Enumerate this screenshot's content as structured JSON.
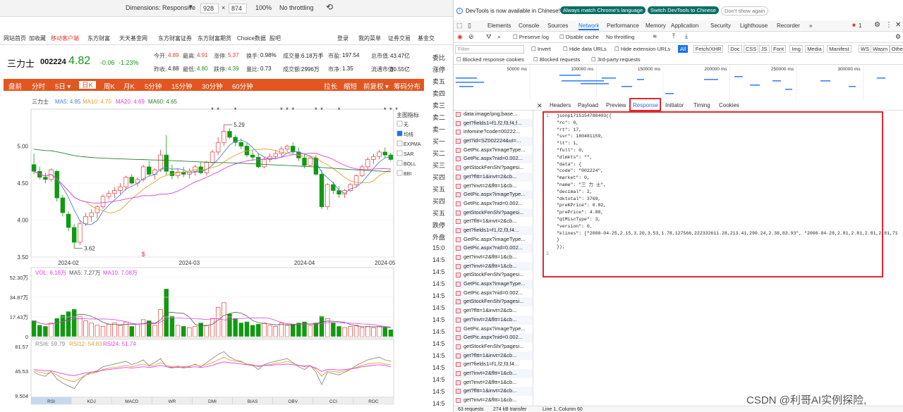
{
  "device_toolbar": {
    "dimensions_label": "Dimensions: Responsive",
    "width": "928",
    "times": "×",
    "height": "874",
    "zoom": "100%",
    "throttle": "No throttling"
  },
  "site_nav": [
    "网站首页",
    "加收藏",
    "移动客户端",
    "东方财富",
    "天天基金网",
    "东方财富证券",
    "东方财富期货",
    "Choice数据",
    "股吧"
  ],
  "site_nav_right": [
    "登录",
    "我的菜单",
    "证券交易",
    "基金交"
  ],
  "stock": {
    "name": "三力士",
    "code": "002224",
    "price": "4.82",
    "change": "-0.06",
    "change_pct": "-1.23%",
    "row1": [
      {
        "label": "今开:",
        "value": "4.89",
        "color": "red"
      },
      {
        "label": "最高:",
        "value": "4.91",
        "color": "red"
      },
      {
        "label": "涨停:",
        "value": "5.37",
        "color": "red"
      },
      {
        "label": "换手:",
        "value": "0.98%",
        "color": "plain"
      },
      {
        "label": "成交量:",
        "value": "6.18万手",
        "color": "plain"
      },
      {
        "label": "市盈:",
        "value": "197.54",
        "color": "plain"
      },
      {
        "label": "总市值:",
        "value": "43.47亿",
        "color": "plain"
      }
    ],
    "row2": [
      {
        "label": "昨收:",
        "value": "4.88",
        "color": "plain"
      },
      {
        "label": "最低:",
        "value": "4.80",
        "color": "green"
      },
      {
        "label": "跌停:",
        "value": "4.39",
        "color": "green"
      },
      {
        "label": "量比:",
        "value": "0.73",
        "color": "plain"
      },
      {
        "label": "成交额:",
        "value": "2996万",
        "color": "plain"
      },
      {
        "label": "市净:",
        "value": "1.35",
        "color": "plain"
      },
      {
        "label": "流通市值:",
        "value": "30.55亿",
        "color": "plain"
      }
    ]
  },
  "period_tabs": [
    "盘前",
    "分时",
    "5日 ▾",
    "日K",
    "周K",
    "月K",
    "5分钟",
    "15分钟",
    "30分钟",
    "60分钟"
  ],
  "period_active": "日K",
  "period_right": [
    "拉长",
    "缩短",
    "前复权 ▾",
    "筹码分布"
  ],
  "chart_header": {
    "name": "三力士",
    "ma": [
      {
        "label": "MA5: 4.85",
        "color": "#4f7fd6"
      },
      {
        "label": "MA10: 4.70",
        "color": "#e0a030"
      },
      {
        "label": "MA20: 4.69",
        "color": "#e040e0"
      },
      {
        "label": "MA60: 4.65",
        "color": "#2e7d32"
      }
    ]
  },
  "indicator_panel": {
    "title": "主图指标",
    "options": [
      "无",
      "均线",
      "EXPMA",
      "SAR",
      "BOLL",
      "BBI"
    ],
    "checked": "均线"
  },
  "bottom_tabs": [
    "RSI",
    "KDJ",
    "MACD",
    "WR",
    "DMI",
    "BIAS",
    "OBV",
    "CCI",
    "ROC"
  ],
  "chart_data": [
    {
      "type": "candlestick",
      "title": "三力士",
      "ylim": [
        3.5,
        5.5
      ],
      "yticks": [
        "5.00",
        "4.50",
        "4.00",
        "3.50"
      ],
      "xticks": [
        "2024-02",
        "2024-03",
        "2024-04",
        "2024-05"
      ],
      "annotations": [
        "5.29",
        "3.62"
      ],
      "series": [
        {
          "name": "MA5: 4.85"
        },
        {
          "name": "MA10: 4.70"
        },
        {
          "name": "MA20: 4.69"
        },
        {
          "name": "MA60: 4.65"
        }
      ],
      "ohlc": [
        [
          4.75,
          4.9,
          4.62,
          4.66
        ],
        [
          4.66,
          4.72,
          4.55,
          4.58
        ],
        [
          4.58,
          4.64,
          4.5,
          4.55
        ],
        [
          4.55,
          4.7,
          4.52,
          4.68
        ],
        [
          4.66,
          4.68,
          4.25,
          4.3
        ],
        [
          4.3,
          4.34,
          4.05,
          4.1
        ],
        [
          4.08,
          4.12,
          3.85,
          3.9
        ],
        [
          3.9,
          3.95,
          3.62,
          3.7
        ],
        [
          3.7,
          3.98,
          3.66,
          3.95
        ],
        [
          3.95,
          4.1,
          3.92,
          4.05
        ],
        [
          4.05,
          4.15,
          3.98,
          4.1
        ],
        [
          4.1,
          4.2,
          4.02,
          4.18
        ],
        [
          4.18,
          4.35,
          4.15,
          4.32
        ],
        [
          4.32,
          4.4,
          4.28,
          4.36
        ],
        [
          4.36,
          4.45,
          4.3,
          4.4
        ],
        [
          4.4,
          4.5,
          4.35,
          4.45
        ],
        [
          4.45,
          4.6,
          4.4,
          4.58
        ],
        [
          4.58,
          4.62,
          4.48,
          4.5
        ],
        [
          4.5,
          4.58,
          4.45,
          4.55
        ],
        [
          4.55,
          4.75,
          4.52,
          4.72
        ],
        [
          4.72,
          4.8,
          4.6,
          4.62
        ],
        [
          4.62,
          4.7,
          4.55,
          4.68
        ],
        [
          4.68,
          4.95,
          4.65,
          4.88
        ],
        [
          4.88,
          5.15,
          4.6,
          4.66
        ],
        [
          4.66,
          4.75,
          4.55,
          4.6
        ],
        [
          4.6,
          4.7,
          4.56,
          4.65
        ],
        [
          4.65,
          4.72,
          4.58,
          4.62
        ],
        [
          4.62,
          4.7,
          4.56,
          4.66
        ],
        [
          4.66,
          4.75,
          4.6,
          4.72
        ],
        [
          4.72,
          4.78,
          4.62,
          4.64
        ],
        [
          4.64,
          4.8,
          4.6,
          4.78
        ],
        [
          4.78,
          4.95,
          4.75,
          4.92
        ],
        [
          4.92,
          5.12,
          4.88,
          5.05
        ],
        [
          5.05,
          5.29,
          5.0,
          5.2
        ],
        [
          5.2,
          5.24,
          5.1,
          5.12
        ],
        [
          5.12,
          5.15,
          5.0,
          5.05
        ],
        [
          5.05,
          5.1,
          4.96,
          5.0
        ],
        [
          5.0,
          5.04,
          4.85,
          4.88
        ],
        [
          4.88,
          4.95,
          4.8,
          4.85
        ],
        [
          4.85,
          4.9,
          4.7,
          4.72
        ],
        [
          4.72,
          4.85,
          4.7,
          4.82
        ],
        [
          4.82,
          4.9,
          4.78,
          4.86
        ],
        [
          4.86,
          4.95,
          4.82,
          4.9
        ],
        [
          4.9,
          5.0,
          4.86,
          4.96
        ],
        [
          4.96,
          5.02,
          4.92,
          5.0
        ],
        [
          5.0,
          5.05,
          4.9,
          4.92
        ],
        [
          4.92,
          4.98,
          4.8,
          4.84
        ],
        [
          4.84,
          4.9,
          4.7,
          4.74
        ],
        [
          4.74,
          4.86,
          4.72,
          4.84
        ],
        [
          4.84,
          4.88,
          4.6,
          4.62
        ],
        [
          4.62,
          4.68,
          4.15,
          4.18
        ],
        [
          4.18,
          4.5,
          4.14,
          4.48
        ],
        [
          4.48,
          4.52,
          4.35,
          4.4
        ],
        [
          4.4,
          4.46,
          4.3,
          4.35
        ],
        [
          4.35,
          4.42,
          4.3,
          4.4
        ],
        [
          4.4,
          4.5,
          4.38,
          4.48
        ],
        [
          4.48,
          4.62,
          4.45,
          4.6
        ],
        [
          4.6,
          4.75,
          4.58,
          4.72
        ],
        [
          4.72,
          4.85,
          4.68,
          4.82
        ],
        [
          4.82,
          4.9,
          4.76,
          4.86
        ],
        [
          4.86,
          4.95,
          4.82,
          4.92
        ],
        [
          4.92,
          4.98,
          4.84,
          4.88
        ],
        [
          4.88,
          4.91,
          4.8,
          4.82
        ]
      ]
    },
    {
      "type": "bar",
      "title": "VOL: 6.18万",
      "ylim": [
        0,
        52.3
      ],
      "yticks": [
        "52.30万",
        "34.87万",
        "17.43万",
        "0"
      ],
      "series": [
        {
          "name": "MA5: 7.27万"
        },
        {
          "name": "MA10: 7.08万"
        }
      ],
      "values": [
        14,
        10,
        9,
        12,
        16,
        19,
        22,
        24,
        18,
        14,
        12,
        10,
        9,
        11,
        12,
        10,
        13,
        9,
        11,
        15,
        14,
        10,
        24,
        42,
        18,
        10,
        9,
        8,
        9,
        12,
        10,
        16,
        26,
        30,
        20,
        16,
        12,
        13,
        10,
        11,
        12,
        10,
        9,
        12,
        10,
        11,
        12,
        13,
        10,
        12,
        18,
        16,
        12,
        9,
        8,
        9,
        10,
        8,
        9,
        8,
        9,
        8,
        6
      ],
      "bar_up": [
        false,
        false,
        false,
        true,
        false,
        false,
        false,
        false,
        true,
        true,
        true,
        true,
        true,
        true,
        true,
        true,
        true,
        false,
        true,
        true,
        false,
        true,
        true,
        false,
        false,
        true,
        false,
        true,
        true,
        false,
        true,
        true,
        true,
        true,
        false,
        false,
        false,
        false,
        false,
        false,
        true,
        true,
        true,
        true,
        true,
        false,
        false,
        false,
        true,
        false,
        false,
        true,
        false,
        false,
        true,
        true,
        true,
        true,
        true,
        true,
        true,
        false,
        false
      ]
    },
    {
      "type": "line",
      "title": "RSI",
      "ylim": [
        9.504,
        81.57
      ],
      "yticks": [
        "81.57",
        "45.53",
        "9.504"
      ],
      "series": [
        {
          "name": "RSI6: 59.79",
          "values": [
            44,
            40,
            38,
            45,
            34,
            28,
            24,
            20,
            32,
            40,
            44,
            46,
            52,
            54,
            56,
            58,
            60,
            55,
            58,
            62,
            54,
            58,
            64,
            52,
            50,
            52,
            50,
            52,
            56,
            52,
            58,
            64,
            70,
            74,
            66,
            62,
            60,
            55,
            54,
            48,
            55,
            58,
            60,
            62,
            64,
            58,
            52,
            48,
            54,
            44,
            26,
            44,
            42,
            40,
            44,
            48,
            54,
            58,
            62,
            64,
            66,
            62,
            60
          ]
        },
        {
          "name": "RSI12: 54.83",
          "values": [
            46,
            44,
            42,
            44,
            40,
            35,
            32,
            30,
            35,
            40,
            42,
            44,
            48,
            50,
            51,
            52,
            54,
            52,
            54,
            56,
            53,
            54,
            58,
            54,
            52,
            53,
            52,
            53,
            55,
            53,
            55,
            58,
            62,
            66,
            62,
            60,
            59,
            56,
            55,
            52,
            54,
            55,
            57,
            58,
            60,
            57,
            54,
            52,
            54,
            48,
            38,
            46,
            45,
            44,
            46,
            48,
            51,
            54,
            56,
            57,
            58,
            56,
            55
          ]
        },
        {
          "name": "RSI24: 51.74",
          "values": [
            48,
            47,
            46,
            46,
            44,
            42,
            40,
            39,
            41,
            43,
            44,
            45,
            47,
            48,
            49,
            50,
            51,
            50,
            51,
            52,
            51,
            52,
            54,
            52,
            51,
            51,
            51,
            51,
            52,
            51,
            52,
            54,
            57,
            59,
            58,
            57,
            56,
            55,
            54,
            53,
            54,
            54,
            55,
            55,
            56,
            55,
            54,
            53,
            53,
            50,
            45,
            48,
            48,
            47,
            48,
            49,
            50,
            52,
            53,
            54,
            55,
            54,
            52
          ]
        }
      ]
    }
  ],
  "page_right_col": [
    "委比",
    "涨停",
    "卖五",
    "卖四",
    "卖三",
    "卖二",
    "卖一",
    "买一",
    "买二",
    "买三",
    "买四",
    "买五",
    "买四",
    "买五",
    "跌停",
    "外盘",
    "15:0",
    "14:5",
    "14:5",
    "14:5",
    "14:5",
    "14:5",
    "14:5",
    "14:5",
    "14:5",
    "14:5",
    "14:5",
    "14:5",
    "14:5",
    "14:5"
  ],
  "devtools": {
    "banner": "DevTools is now available in Chinese!",
    "banner_btn1": "Always match Chrome's language",
    "banner_btn2": "Switch DevTools to Chinese",
    "banner_btn3": "Don't show again",
    "main_tabs": [
      "Elements",
      "Console",
      "Sources",
      "Network",
      "Performance",
      "Memory",
      "Application",
      "Security",
      "Lighthouse",
      "Recorder",
      "»"
    ],
    "main_active": "Network",
    "err_count": "1",
    "preserve_log": "Preserve log",
    "disable_cache": "Disable cache",
    "throttle": "No throttling",
    "filter_placeholder": "Filter",
    "invert": "Invert",
    "hide_data_urls": "Hide data URLs",
    "hide_ext_urls": "Hide extension URLs",
    "types": [
      "All",
      "Fetch/XHR",
      "Doc",
      "CSS",
      "JS",
      "Font",
      "Img",
      "Media",
      "Manifest",
      "WS",
      "Wasm",
      "Other"
    ],
    "blocked_cookies": "Blocked response cookies",
    "blocked_requests": "Blocked requests",
    "third_party": "3rd-party requests",
    "timeline_ticks": [
      "50000 ms",
      "100000 ms",
      "150000 ms",
      "200000 ms",
      "250000 ms",
      "300000 ms"
    ],
    "detail_tabs": [
      "Headers",
      "Payload",
      "Preview",
      "Response",
      "Initiator",
      "Timing",
      "Cookies"
    ],
    "detail_active": "Response",
    "requests": [
      "data:image/png;base...",
      "get?fields1=f1,f2,f3,f4,f...",
      "infomine?code=00222...",
      "get?id=SZ002224&ut=...",
      "GetPic.aspx?imageType...",
      "GetPic.aspx?nid=0.002...",
      "getStockFenShi?pagesi...",
      "get?fltt=1&invt=2&cb...",
      "get?invt=2&fltt=1&cb...",
      "GetPic.aspx?imageType...",
      "GetPic.aspx?nid=0.002...",
      "getStockFenShi?pagesi...",
      "get?fltt=1&invt=2&cb...",
      "get?fields1=f1,f2,f3,f4...",
      "GetPic.aspx?imageType...",
      "GetPic.aspx?nid=0.002...",
      "get?invt=2&fltt=1&cb...",
      "get?invt=2&fltt=1&cb...",
      "getStockFenShi?pagesi...",
      "GetPic.aspx?imageType...",
      "GetPic.aspx?nid=0.002...",
      "getStockFenShi?pagesi...",
      "get?fltt=1&invt=2&cb...",
      "get?invt=2&fltt=1&cb...",
      "GetPic.aspx?imageType...",
      "GetPic.aspx?nid=0.002...",
      "getStockFenShi?pagesi...",
      "get?fltt=1&invt=2&cb...",
      "get?fields1=f1,f2,f3,f4...",
      "get?invt=2&fltt=1&cb...",
      "get?invt=2&fltt=1&cb...",
      "get?fltt=1&invt=2&cb...",
      "get?invt=2&fltt=1&cb..."
    ],
    "code_lines": [
      {
        "n": "1",
        "t": "jsonp1715154780403({"
      },
      {
        "n": "",
        "t": "    \"rc\": 0,"
      },
      {
        "n": "",
        "t": "    \"rt\": 17,"
      },
      {
        "n": "",
        "t": "    \"svr\": 180481159,"
      },
      {
        "n": "",
        "t": "    \"lt\": 1,"
      },
      {
        "n": "",
        "t": "    \"full\": 0,"
      },
      {
        "n": "",
        "t": "    \"dlmkts\": \"\","
      },
      {
        "n": "",
        "t": "    \"data\": {"
      },
      {
        "n": "",
        "t": "        \"code\": \"002224\","
      },
      {
        "n": "",
        "t": "        \"market\": 0,"
      },
      {
        "n": "",
        "t": "        \"name\": \"三 力 士\","
      },
      {
        "n": "",
        "t": "        \"decimal\": 2,"
      },
      {
        "n": "",
        "t": "        \"dktotal\": 3769,"
      },
      {
        "n": "",
        "t": "        \"preKPrice\": 0.82,"
      },
      {
        "n": "",
        "t": "        \"prePrice\": 4.88,"
      },
      {
        "n": "",
        "t": "        \"qtMiscType\": 3,"
      },
      {
        "n": "",
        "t": "        \"version\": 0,"
      },
      {
        "n": "",
        "t": "        \"klines\": [\"2008-04-25,2.15,3.20,3.53,1.78,127566,222332611.28,213.41,290.24,2.38,83.93\", \"2008-04-28,2.81,2.81,2.81,2.81,71"
      },
      {
        "n": "",
        "t": "    }"
      },
      {
        "n": "",
        "t": "});"
      },
      {
        "n": "2",
        "t": ""
      }
    ],
    "status": [
      "63 requests",
      "274 kB transfer",
      "Line 1, Column 60"
    ]
  },
  "watermark": "CSDN @利哥AI实例探险,"
}
